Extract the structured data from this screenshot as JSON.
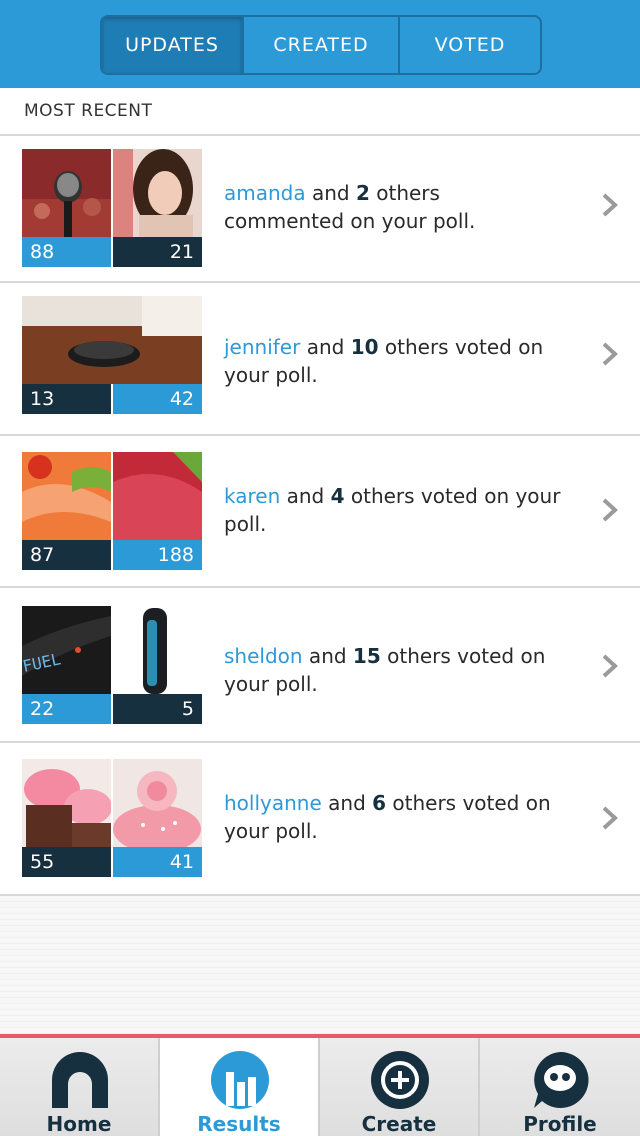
{
  "header": {
    "tabs": [
      {
        "label": "UPDATES",
        "active": true
      },
      {
        "label": "CREATED",
        "active": false
      },
      {
        "label": "VOTED",
        "active": false
      }
    ]
  },
  "section": {
    "title": "MOST RECENT"
  },
  "feed": [
    {
      "user": "amanda",
      "count": "2",
      "pre": " and ",
      "post": " others commented on your poll.",
      "left_count": "88",
      "right_count": "21",
      "left_color": "blue",
      "right_color": "dark",
      "left_img": "microphone",
      "right_img": "woman-portrait"
    },
    {
      "user": "jennifer",
      "count": "10",
      "pre": " and ",
      "post": " others voted on your poll.",
      "left_count": "13",
      "right_count": "42",
      "left_color": "dark",
      "right_color": "blue",
      "left_img": "robot-vacuum",
      "right_img": "robot-vacuum"
    },
    {
      "user": "karen",
      "count": "4",
      "pre": " and ",
      "post": " others voted on your poll.",
      "left_count": "87",
      "right_count": "188",
      "left_color": "dark",
      "right_color": "blue",
      "left_img": "salmon-sushi",
      "right_img": "tuna-sashimi"
    },
    {
      "user": "sheldon",
      "count": "15",
      "pre": " and ",
      "post": " others voted on your poll.",
      "left_count": "22",
      "right_count": "5",
      "left_color": "blue",
      "right_color": "dark",
      "left_img": "fuel-band",
      "right_img": "clip-tracker"
    },
    {
      "user": "hollyanne",
      "count": "6",
      "pre": " and ",
      "post": " others voted on your poll.",
      "left_count": "55",
      "right_count": "41",
      "left_color": "dark",
      "right_color": "blue",
      "left_img": "cupcakes",
      "right_img": "rose-cake"
    }
  ],
  "tabbar": [
    {
      "label": "Home",
      "icon": "home-arch-icon",
      "active": false
    },
    {
      "label": "Results",
      "icon": "bar-chart-icon",
      "active": true
    },
    {
      "label": "Create",
      "icon": "plus-circle-icon",
      "active": false
    },
    {
      "label": "Profile",
      "icon": "chat-bubble-icon",
      "active": false
    }
  ],
  "colors": {
    "brand": "#2d9ad8",
    "dark": "#17303f",
    "accent": "#e85a6a"
  }
}
